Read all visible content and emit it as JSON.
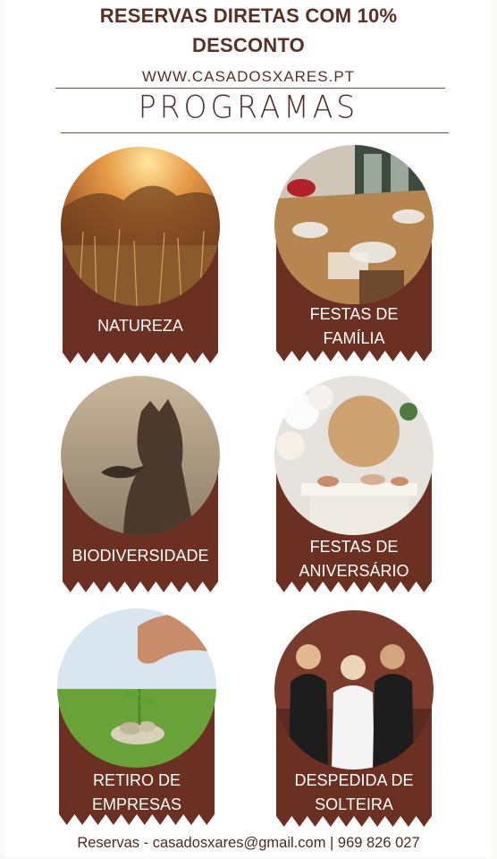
{
  "header": {
    "line1": "RESERVAS DIRETAS COM 10%",
    "line2": "DESCONTO",
    "website": "WWW.CASADOSXARES.PT",
    "section_title": "PROGRAMAS"
  },
  "programs": [
    {
      "label1": "NATUREZA",
      "label2": "",
      "photo": "sunset-meadow"
    },
    {
      "label1": "FESTAS DE",
      "label2": "FAMÍLIA",
      "photo": "dining-table"
    },
    {
      "label1": "BIODIVERSIDADE",
      "label2": "",
      "photo": "deer-and-bird"
    },
    {
      "label1": "FESTAS DE",
      "label2": "ANIVERSÁRIO",
      "photo": "party-balloons"
    },
    {
      "label1": "RETIRO DE",
      "label2": "EMPRESAS",
      "photo": "hand-plant-coins"
    },
    {
      "label1": "DESPEDIDA DE",
      "label2": "SOLTEIRA",
      "photo": "bride-friends"
    }
  ],
  "footer": {
    "text": "Reservas - casadosxares@gmail.com |  969 826 027"
  },
  "colors": {
    "brown": "#6b3022",
    "text": "#5b3024"
  }
}
